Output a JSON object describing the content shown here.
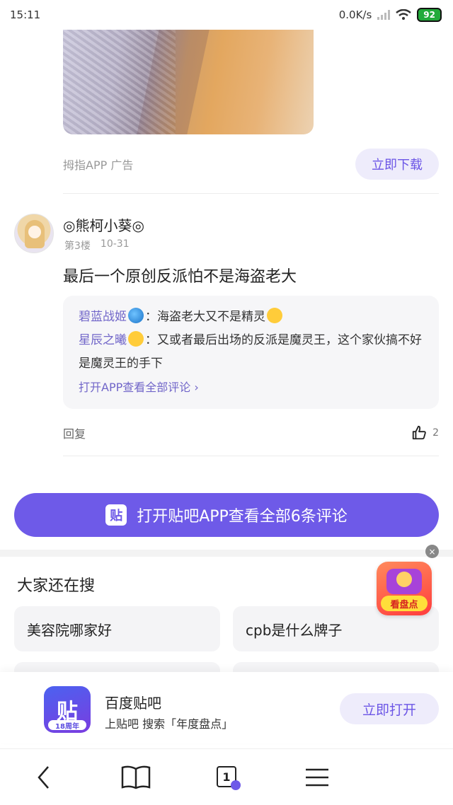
{
  "status_bar": {
    "time": "15:11",
    "network_speed": "0.0K/s",
    "battery": "92"
  },
  "ad": {
    "label": "拇指APP 广告",
    "download_button": "立即下载"
  },
  "post": {
    "username": "◎熊柯小葵◎",
    "floor": "第3楼",
    "date": "10-31",
    "text": "最后一个原创反派怕不是海盗老大",
    "replies": [
      {
        "name": "碧蓝战姬",
        "emoji": "globe",
        "text": "：海盗老大又不是精灵",
        "tail_emoji": "smug"
      },
      {
        "name": "星辰之曦",
        "emoji": "smug",
        "text": "：又或者最后出场的反派是魔灵王，这个家伙搞不好是魔灵王的手下"
      }
    ],
    "open_all": "打开APP查看全部评论 ›",
    "reply_label": "回复",
    "like_count": "2"
  },
  "cta": {
    "icon_text": "贴",
    "label": "打开贴吧APP查看全部6条评论"
  },
  "search": {
    "title": "大家还在搜",
    "chips": [
      "美容院哪家好",
      "cpb是什么牌子",
      "",
      ""
    ]
  },
  "floating": {
    "badge_text": "看盘点",
    "close": "×"
  },
  "app_banner": {
    "icon_text": "贴",
    "anniversary": "18周年",
    "name": "百度贴吧",
    "subtitle": "上贴吧 搜索「年度盘点」",
    "open_button": "立即打开"
  },
  "nav": {
    "tab_count": "1"
  },
  "colors": {
    "accent": "#6e5ae8",
    "accent_light": "#eeecfb"
  }
}
